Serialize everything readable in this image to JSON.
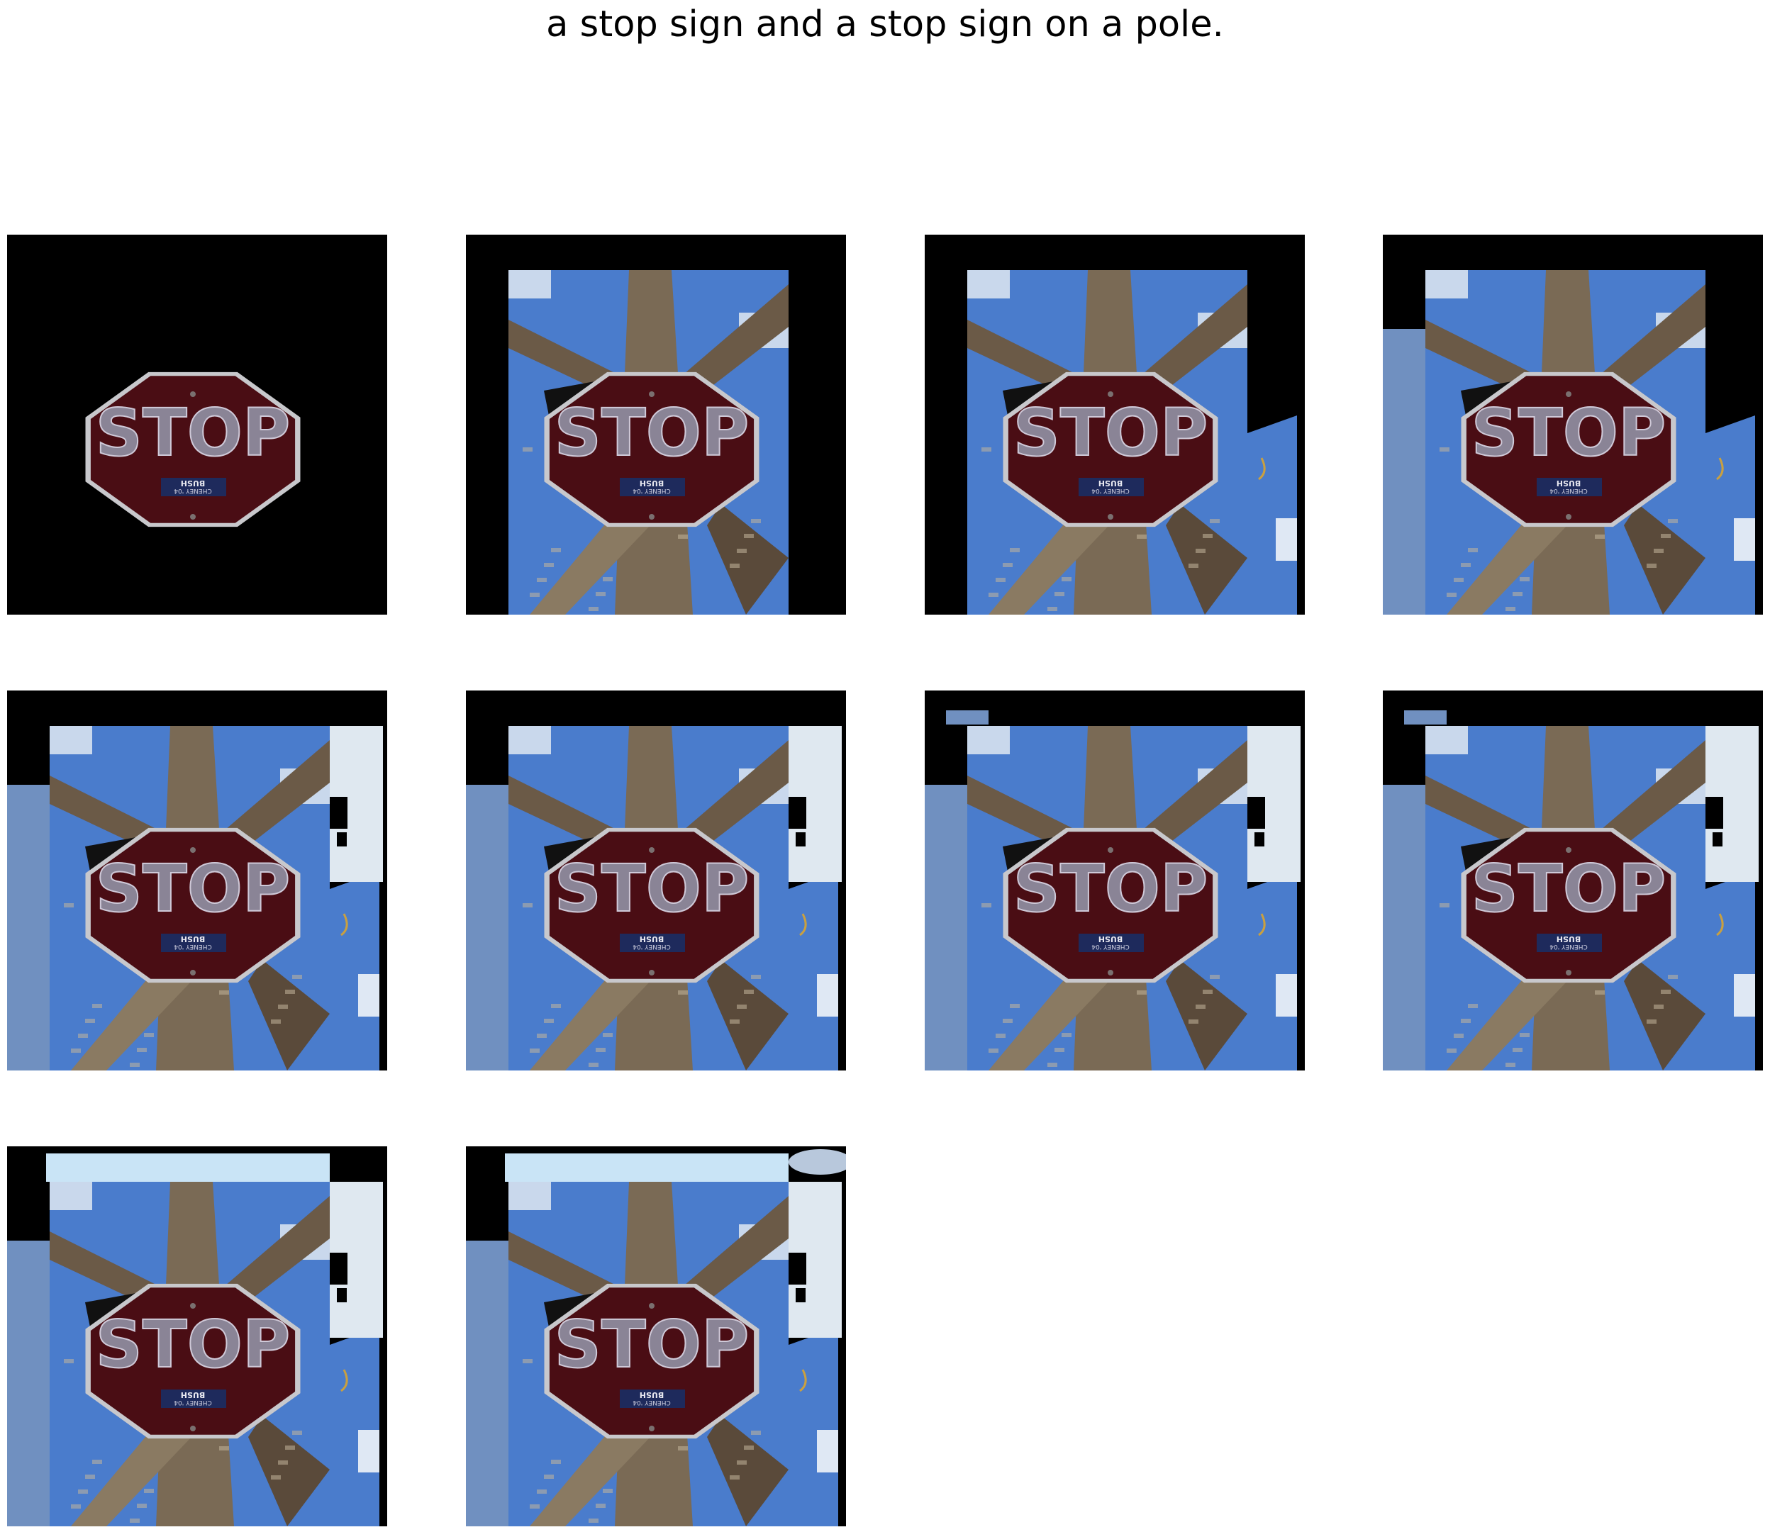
{
  "figure": {
    "title": "a stop sign and a stop sign on a pole."
  },
  "sign": {
    "main_text": "STOP",
    "sticker_line1": "BUSH",
    "sticker_line2": "CHENEY '04"
  },
  "colors": {
    "background": "#ffffff",
    "mask": "#000000",
    "sign_red": "#4a0d14",
    "sign_rim": "#c8c8cc",
    "sign_letters": "#8a8496",
    "bark": "#7a6a55",
    "sky": "#4a7ccc",
    "pale_sky": "#dfe8f0",
    "strip_blue": "#7090c0"
  },
  "panels": [
    {
      "id": "panel-1",
      "reveal": "sign_only"
    },
    {
      "id": "panel-2",
      "reveal": "tree_center"
    },
    {
      "id": "panel-3",
      "reveal": "tree_center_plus_right_sky"
    },
    {
      "id": "panel-4",
      "reveal": "tree_center_plus_right_sky_plus_left_strip"
    },
    {
      "id": "panel-5",
      "reveal": "extended_both_sides"
    },
    {
      "id": "panel-6",
      "reveal": "extended_both_sides"
    },
    {
      "id": "panel-7",
      "reveal": "extended_both_sides_top_fragment"
    },
    {
      "id": "panel-8",
      "reveal": "extended_both_sides_top_fragment"
    },
    {
      "id": "panel-9",
      "reveal": "extended_with_top_sky"
    },
    {
      "id": "panel-10",
      "reveal": "extended_with_top_sky_and_clouds"
    }
  ]
}
